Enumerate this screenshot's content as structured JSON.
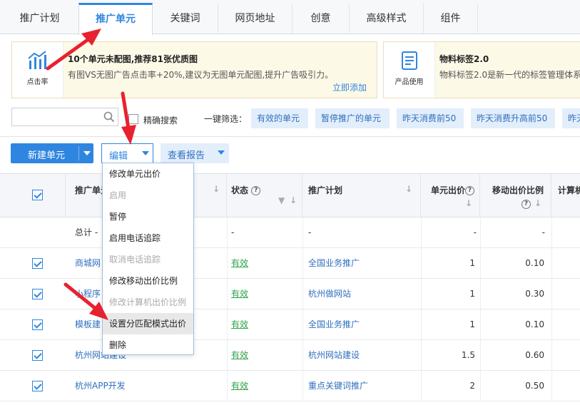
{
  "tabs": [
    {
      "label": "推广计划"
    },
    {
      "label": "推广单元"
    },
    {
      "label": "关键词"
    },
    {
      "label": "网页地址"
    },
    {
      "label": "创意"
    },
    {
      "label": "高级样式"
    },
    {
      "label": "组件"
    }
  ],
  "banners": [
    {
      "icon": "bar-chart-arrow-icon",
      "icon_label": "点击率",
      "title": "10个单元未配图,推荐81张优质图",
      "desc": "有图VS无图广告点击率+20%,建议为无图单元配图,提升广告吸引力。",
      "link": "立即添加"
    },
    {
      "icon": "document-icon",
      "icon_label": "产品使用",
      "title": "物料标签2.0",
      "desc": "物料标签2.0是新一代的标签管理体系"
    }
  ],
  "search": {
    "placeholder": "",
    "exact_label": "精确搜索"
  },
  "filters": {
    "label": "一键筛选：",
    "chips": [
      "有效的单元",
      "暂停推广的单元",
      "昨天消费前50",
      "昨天消费升高前50",
      "昨天"
    ]
  },
  "toolbar": {
    "new_unit": "新建单元",
    "edit": "编辑",
    "report": "查看报告"
  },
  "edit_menu": [
    {
      "label": "修改单元出价",
      "disabled": false
    },
    {
      "label": "启用",
      "disabled": true
    },
    {
      "label": "暂停",
      "disabled": false
    },
    {
      "label": "启用电话追踪",
      "disabled": false
    },
    {
      "label": "取消电话追踪",
      "disabled": true
    },
    {
      "label": "修改移动出价比例",
      "disabled": false
    },
    {
      "label": "修改计算机出价比例",
      "disabled": true
    },
    {
      "label": "设置分匹配模式出价",
      "disabled": false,
      "hovered": true
    },
    {
      "label": "删除",
      "disabled": false
    }
  ],
  "table": {
    "headers": {
      "unit": "推广单元",
      "status": "状态",
      "plan": "推广计划",
      "bid": "单元出价",
      "mobile_ratio": "移动出价比例",
      "pc": "计算机"
    },
    "total": {
      "label": "总计 -",
      "status": "-",
      "plan": "-",
      "bid": "-",
      "mobile_ratio": "-"
    },
    "rows": [
      {
        "unit": "商城网",
        "status": "有效",
        "plan": "全国业务推广",
        "bid": "1",
        "mobile_ratio": "0.10"
      },
      {
        "unit": "小程序",
        "status": "有效",
        "plan": "杭州做网站",
        "bid": "1",
        "mobile_ratio": "0.30"
      },
      {
        "unit": "模板建",
        "status": "有效",
        "plan": "全国业务推广",
        "bid": "1",
        "mobile_ratio": "0.10"
      },
      {
        "unit": "杭州网站建设",
        "status": "有效",
        "plan": "杭州网站建设",
        "bid": "1.5",
        "mobile_ratio": "0.60"
      },
      {
        "unit": "杭州APP开发",
        "status": "有效",
        "plan": "重点关键词推广",
        "bid": "2",
        "mobile_ratio": "0.50"
      }
    ]
  },
  "colors": {
    "accent": "#2f86e0",
    "status_ok": "#2ea24a",
    "annotation_arrow": "#e8212f"
  }
}
